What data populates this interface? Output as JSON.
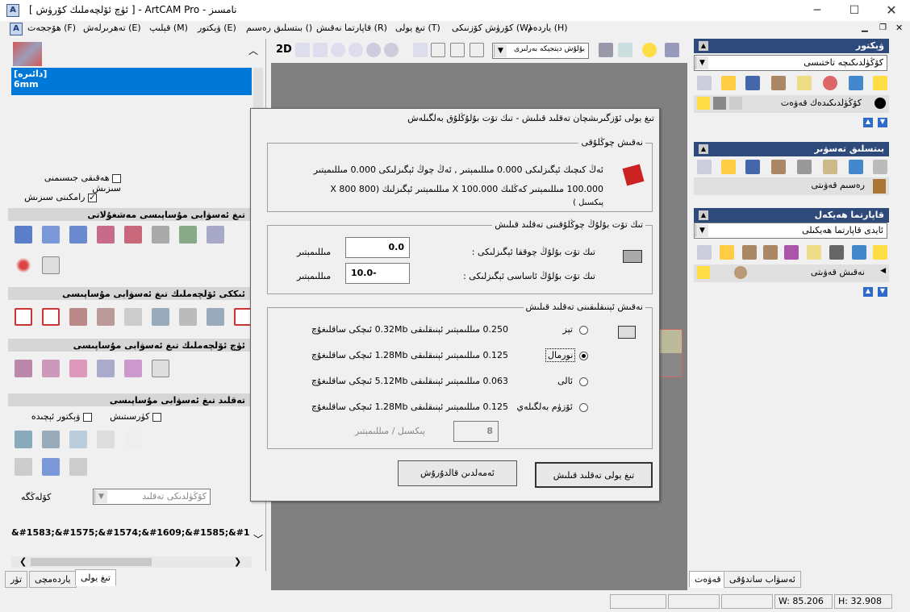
{
  "window": {
    "title": "[ ئۈچ ئۆلچەملىك كۆرۈش ] - ArtCAM Pro - نامسىز",
    "app_icon": "A"
  },
  "menu": [
    "ياردەم (H)",
    "كۆرۈش كۆزنىكى (W)",
    "تىغ يولى (T)",
    "قاپارتما نەقىش (R)",
    "بىتسلىق رەسىم ()",
    "ۋېكتور (E)",
    "قېلىپ (M)",
    "تەھرىرلەش (E)",
    "ھۆججەت (F)"
  ],
  "left_panel": {
    "list_items": [
      "[دائىرە]",
      "6mm"
    ],
    "checkbox1": "ھەقىقى جىسىمنى سىزىش",
    "checkbox2": "رامكىنى سىزىش",
    "sec1": "تىغ ئەسۋابى مۇساپىسى مەشغۇلاتى",
    "sec2": "ئىككى ئۆلچەملىك تىغ ئەسۋابى مۇساپىسى",
    "sec3": "ئۈچ ئۆلچەملىك تىغ ئەسۋابى مۇساپىسى",
    "sec4": "تەقلىد تىغ ئەسۋابى مۇساپىسى",
    "chk_curve": "كۈرسىتىش",
    "chk_vector": "ۋېكتور ئېچىدە",
    "combo_label": "كۆلەڭگە",
    "combo_value": "كۆڭۈلدىكى تەقلىد",
    "encoded_text": "&#1583;&#1575;&#1574;&#1609;&#1585;&#1"
  },
  "bottom_tabs": [
    "تۈر",
    "ياردەمچى",
    "تىغ يولى"
  ],
  "toolbar": {
    "btn_2d": "2D",
    "view_combo": "بۇلۇش دېتجېكە بەرلىرى"
  },
  "right_panel": {
    "vector_hdr": "ۋېكتور",
    "vector_combo": "كۆڭۈلدىكىچە تاختىسى",
    "vector_layer": "كۆڭۈلدىكىدەك قەۋەت",
    "bitmap_hdr": "بىتسلىق تەسۋىر",
    "bitmap_layer": "رەسىم قەۋىتى",
    "relief_hdr": "قاپارتما ھەيكەل",
    "relief_combo": "ئايدى قاپارتما ھەيكىلى",
    "relief_layer": "نەقىش قەۋىتى",
    "tab_layer": "قەۋەت",
    "tab_toolbox": "ئەسۋاب ساندۇقى"
  },
  "dialog": {
    "title": "تىغ يولى ئۆزگىرىشچان تەقلىد قىلىش - تىك تۆت بۇلۇڭلۇق بەلگىلەش",
    "g1_title": "نەقىش چوڭلۇقى",
    "g1_line1": "ئەڭ كىچىك ئېگىزلىكى   0.000   مىللىمېتىر ,  ئەڭ چوڭ ئېگىزلىكى   0.000   مىللىمېتىر",
    "g1_line2": "100.000   مىللىمېتىر   كەڭلىك   100.000  X  مىللىمېتىر   ئېگىزلىك   (800 X 800",
    "g1_line3": "پىكسىل )",
    "g2_title": "تىك تۆت بۇلۇڭ چوڭلۇقىنى تەقلىد قىلىش",
    "g2_row1_label": "تىك تۆت بۇلۇڭ چوققا ئېگىزلىكى :",
    "g2_row1_value": "0.0",
    "g2_row1_unit": "مىللىمېتىر",
    "g2_row2_label": "تىك تۆت بۇلۇڭ ئاساسى ئېگىزلىكى :",
    "g2_row2_value": "-10.0",
    "g2_row2_unit": "مىللىمېتىر",
    "g3_title": "نەقىش ئېنىقلىقىنى تەقلىد قىلىش",
    "opt1_label": "تېز",
    "opt1_info": "0.250   مىللىمېتىر   ئېنىقلىقى   0.32Mb  ئىچكى ساقلىغۇچ",
    "opt2_label": "نورمال",
    "opt2_info": "0.125   مىللىمېتىر   ئېنىقلىقى   1.28Mb  ئىچكى ساقلىغۇچ",
    "opt3_label": "ئالى",
    "opt3_info": "0.063   مىللىمېتىر   ئېنىقلىقى   5.12Mb  ئىچكى ساقلىغۇچ",
    "opt4_label": "ئۆزۈم بەلگىلەي",
    "opt4_info": "0.125   مىللىمېتىر   ئېنىقلىقى   1.28Mb  ئىچكى ساقلىغۇچ",
    "custom_value": "8",
    "custom_units": "پىكسىل  /   مىللىمېتىر",
    "btn_ok": "تىغ يولى تەقلىد قىلىش",
    "btn_cancel": "ئەمەلدىن قالدۇرۇش"
  },
  "status": {
    "w": "W: 85.206",
    "h": "H: 32.908"
  },
  "colors": {
    "canvas": "#808080",
    "dark_header": "#2e4a7a",
    "list_selected": "#0078d7"
  }
}
